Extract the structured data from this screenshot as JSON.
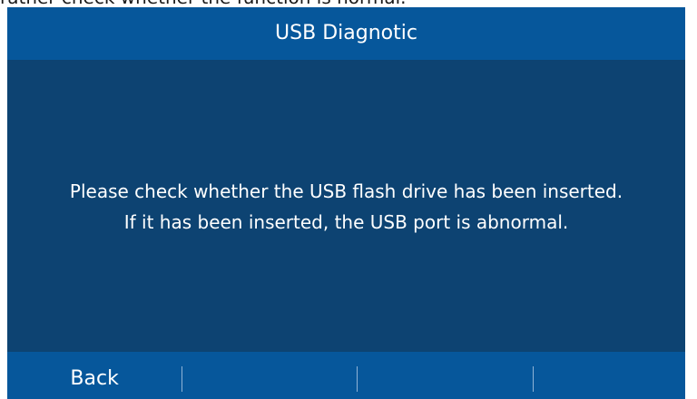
{
  "doc_snippet": "rather check whether the function is normal.",
  "window": {
    "title": "USB Diagnotic"
  },
  "message": {
    "line1": "Please check whether the USB flash drive has been inserted.",
    "line2": "If it has been inserted, the USB port is abnormal."
  },
  "softkeys": [
    {
      "label": "Back"
    },
    {
      "label": ""
    },
    {
      "label": ""
    },
    {
      "label": ""
    }
  ],
  "colors": {
    "title_bar": "#06579b",
    "content_bg": "#0d4372",
    "softkey_bar": "#06579b",
    "text": "#ffffff"
  }
}
